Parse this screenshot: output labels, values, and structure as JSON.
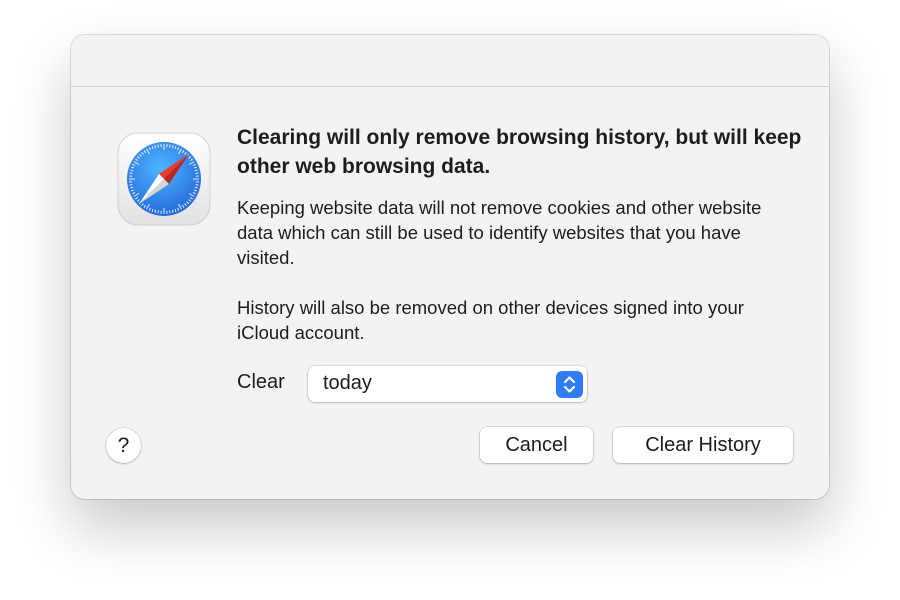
{
  "dialog": {
    "headline": "Clearing will only remove browsing history, but will keep other web browsing data.",
    "body_1": "Keeping website data will not remove cookies and other website data which can still be used to identify websites that you have visited.",
    "body_2": "History will also be removed on other devices signed into your iCloud account.",
    "clear_label": "Clear",
    "clear_popup": {
      "selected": "today"
    },
    "help_label": "?",
    "buttons": {
      "cancel": "Cancel",
      "clear_history": "Clear History"
    },
    "app_icon": "safari-compass-icon"
  },
  "colors": {
    "dialog_background": "#f3f3f3",
    "accent": "#2f7cf6",
    "compass_red": "#e83a2e",
    "text": "#1d1d1f"
  }
}
